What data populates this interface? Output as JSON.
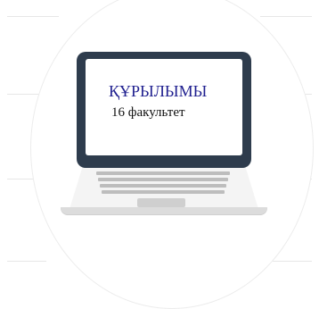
{
  "card": {
    "title": "ҚҰРЫЛЫМЫ",
    "subtitle": "16 факультет"
  },
  "colors": {
    "screen_frame": "#2e3c4d",
    "title_text": "#1f1f8f",
    "subtitle_text": "#111111",
    "laptop_body": "#f1f1f1",
    "keys": "#bdbdbd"
  },
  "icons": [
    "laptop-icon"
  ]
}
